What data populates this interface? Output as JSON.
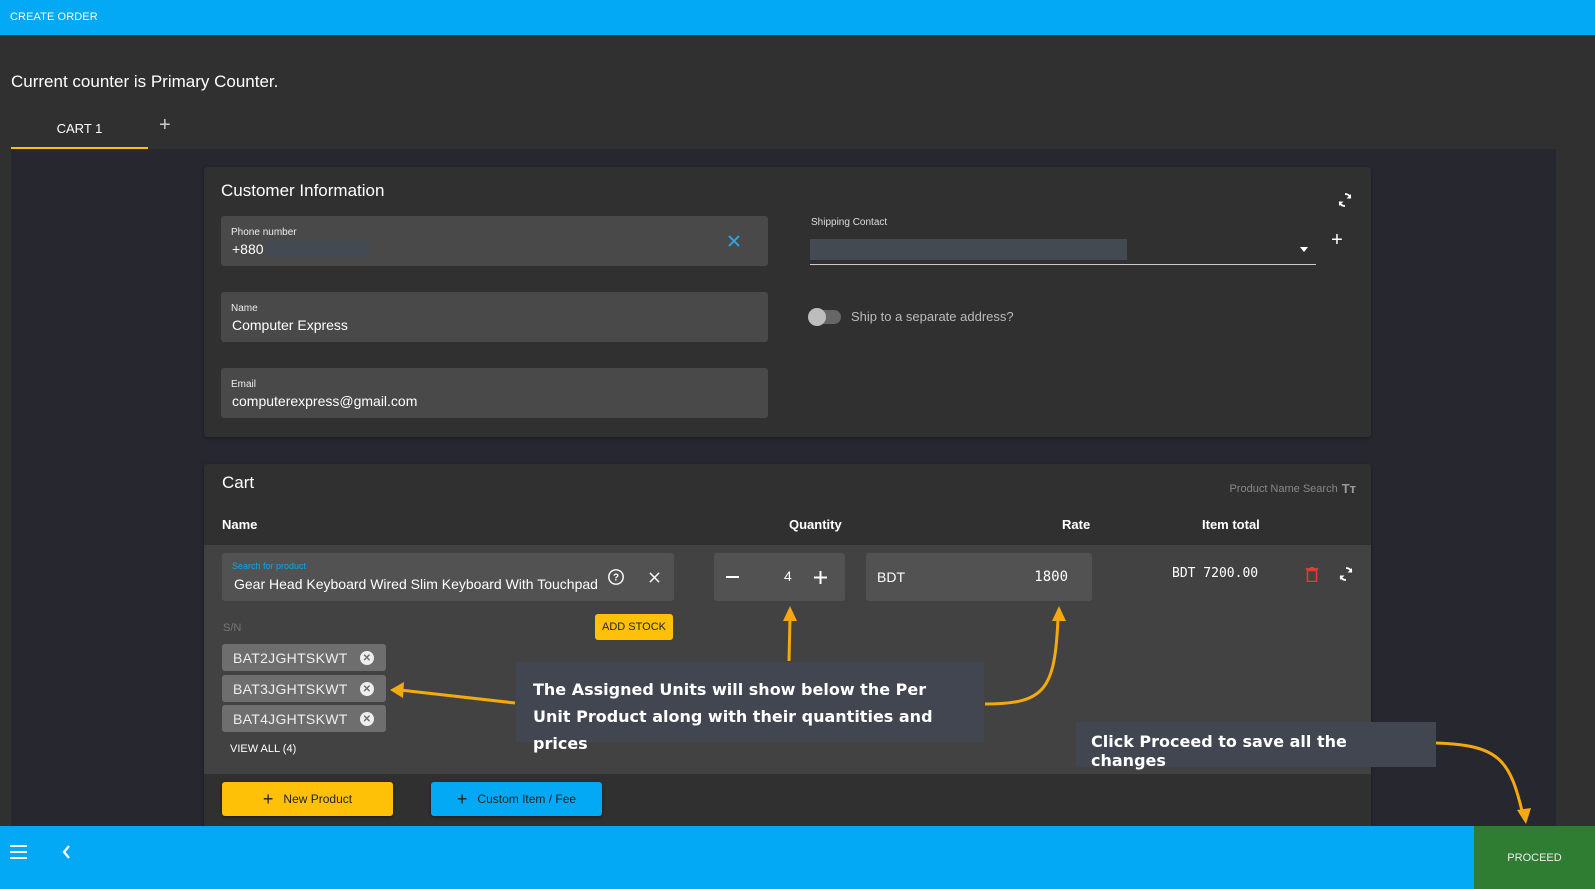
{
  "app": {
    "title": "CREATE ORDER"
  },
  "counter_message": "Current counter is Primary Counter.",
  "tabs": [
    {
      "label": "CART 1",
      "active": true
    }
  ],
  "customer": {
    "title": "Customer Information",
    "phone": {
      "label": "Phone number",
      "value": "+880"
    },
    "name": {
      "label": "Name",
      "value": "Computer Express"
    },
    "email": {
      "label": "Email",
      "value": "computerexpress@gmail.com"
    },
    "shipping_contact": {
      "label": "Shipping Contact",
      "value": ""
    },
    "ship_separate": {
      "label": "Ship to a separate address?",
      "checked": false
    }
  },
  "cart": {
    "title": "Cart",
    "search_mode": "Product Name Search",
    "columns": {
      "name": "Name",
      "quantity": "Quantity",
      "rate": "Rate",
      "item_total": "Item total"
    },
    "items": [
      {
        "search_label": "Search for product",
        "product": "Gear Head Keyboard Wired Slim Keyboard With Touchpad",
        "quantity": "4",
        "currency": "BDT",
        "rate": "1800",
        "item_total": "BDT 7200.00",
        "sn_label": "S/N",
        "add_stock_label": "ADD STOCK",
        "serials": [
          "BAT2JGHTSKWT",
          "BAT3JGHTSKWT",
          "BAT4JGHTSKWT"
        ],
        "view_all_label": "VIEW ALL (4)"
      }
    ],
    "new_product_label": "New Product",
    "custom_item_label": "Custom Item / Fee"
  },
  "annotations": {
    "units": "The Assigned Units will show below the Per Unit Product along with their quantities and prices",
    "proceed": "Click Proceed to save all the changes",
    "arrow_color": "#f4a90f"
  },
  "footer": {
    "proceed_label": "PROCEED"
  },
  "colors": {
    "primary": "#03a9f4",
    "accent": "#ffc107",
    "success": "#2e7d32",
    "danger": "#e53935"
  }
}
